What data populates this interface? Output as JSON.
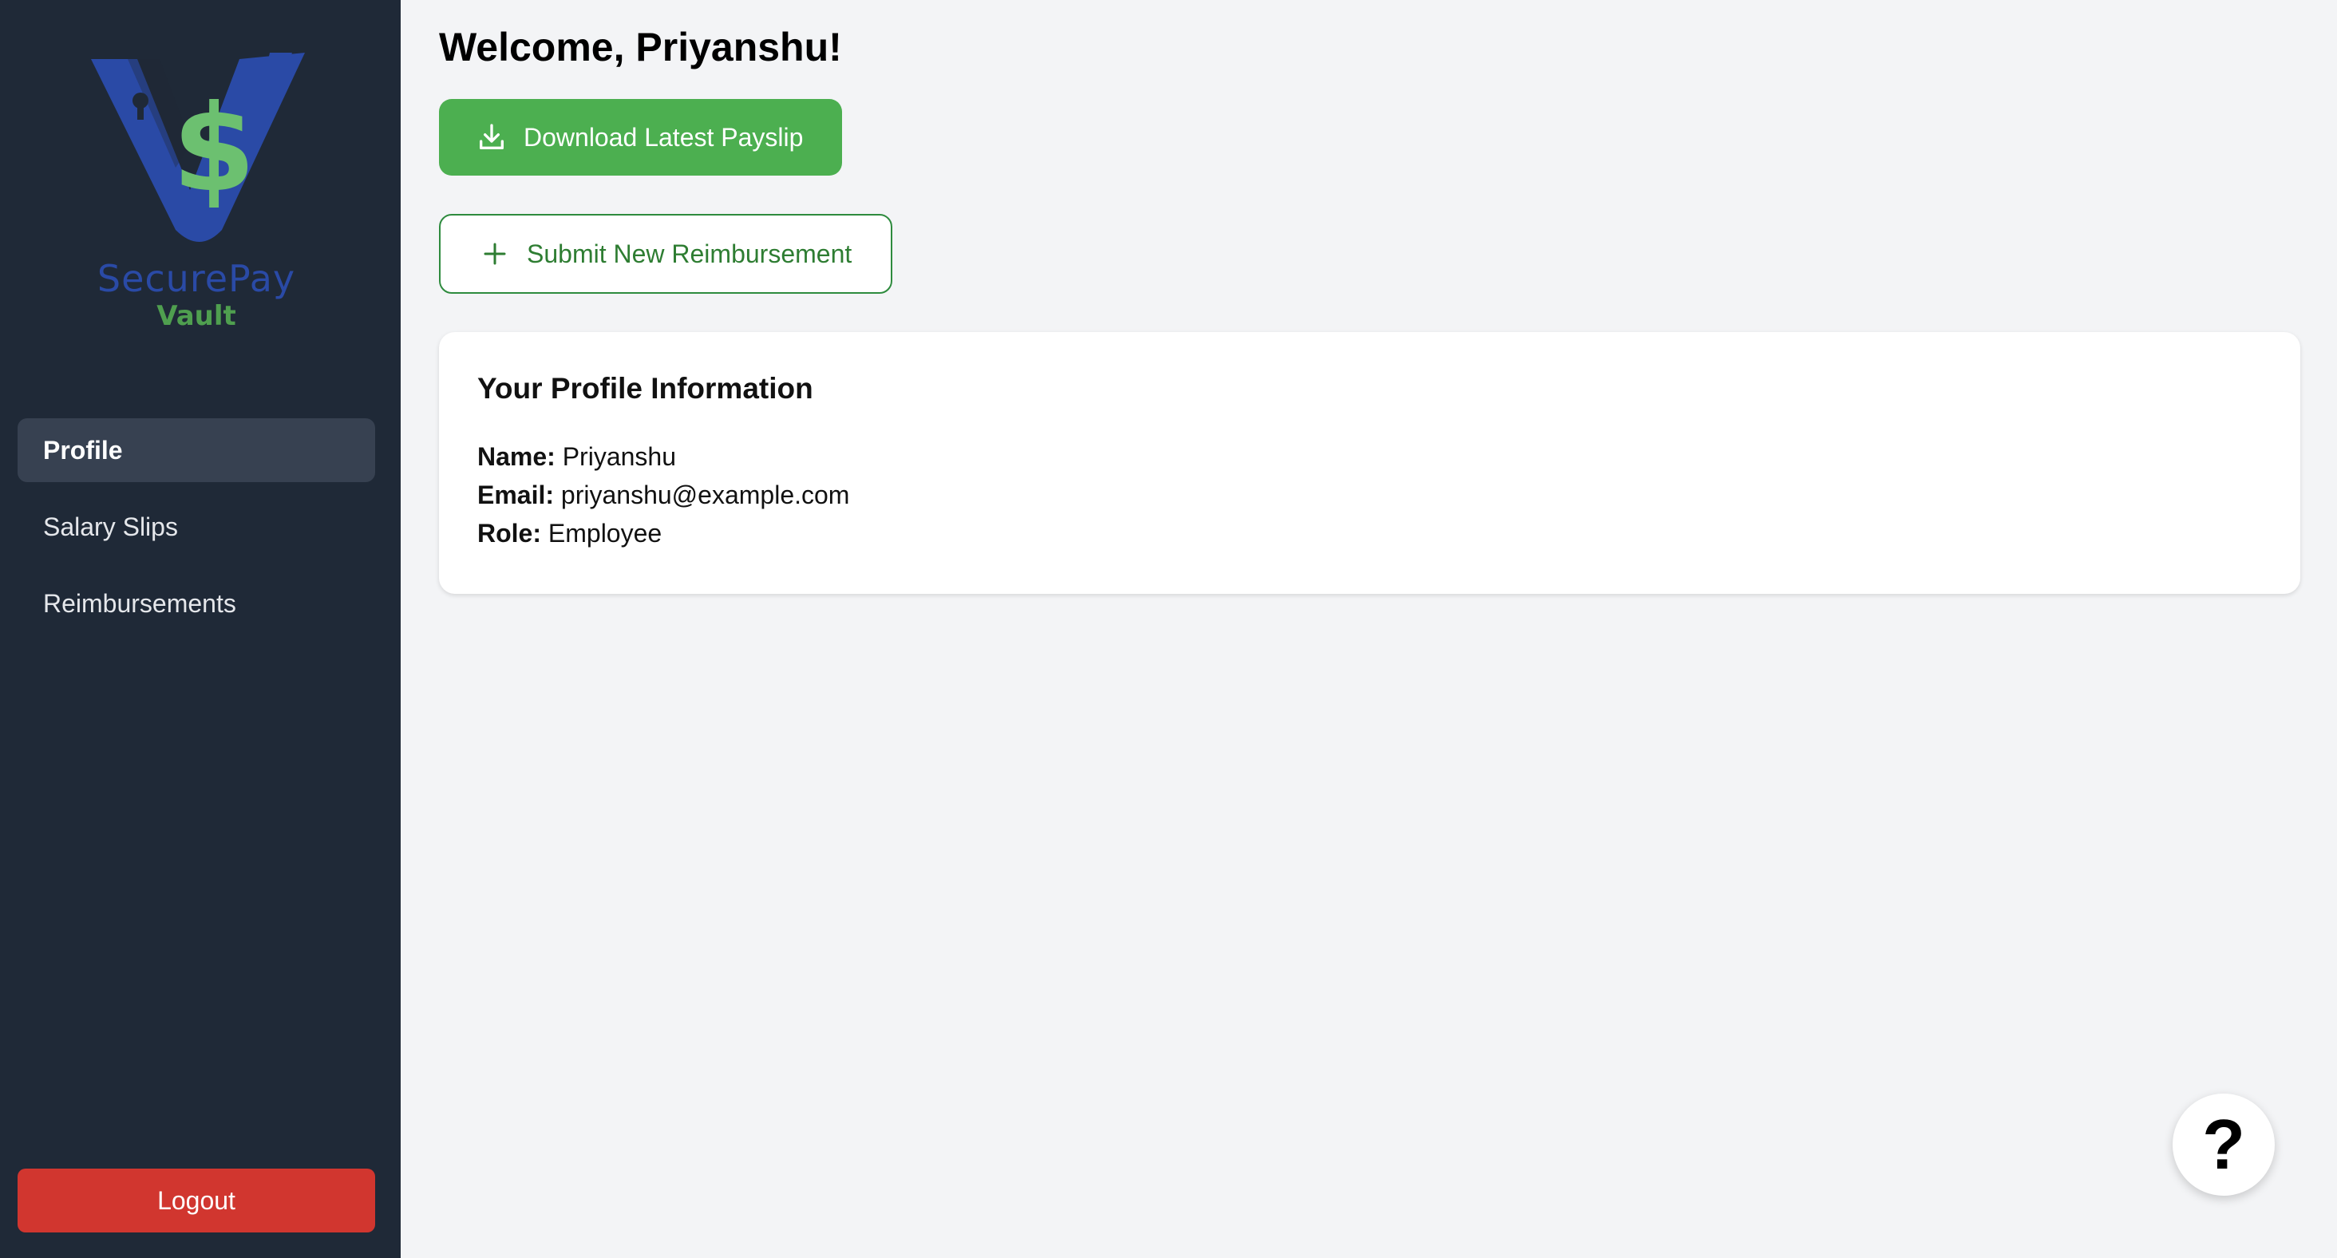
{
  "sidebar": {
    "logo": {
      "line1": "SecurePay",
      "line2": "Vault",
      "icon": "shield-dollar-logo"
    },
    "items": [
      {
        "label": "Profile",
        "active": true
      },
      {
        "label": "Salary Slips",
        "active": false
      },
      {
        "label": "Reimbursements",
        "active": false
      }
    ],
    "logout_label": "Logout"
  },
  "main": {
    "welcome": "Welcome, Priyanshu!",
    "download_button": {
      "label": "Download Latest Payslip",
      "icon": "download-icon"
    },
    "submit_button": {
      "label": "Submit New Reimbursement",
      "icon": "plus-icon"
    },
    "profile": {
      "title": "Your Profile Information",
      "name_label": "Name:",
      "name_value": "Priyanshu",
      "email_label": "Email:",
      "email_value": "priyanshu@example.com",
      "role_label": "Role:",
      "role_value": "Employee"
    }
  },
  "help_button": {
    "label": "?",
    "icon": "help-icon"
  },
  "colors": {
    "sidebar_bg": "#1f2937",
    "active_item_bg": "#374151",
    "primary_green": "#4caf50",
    "logout_red": "#d1362f",
    "page_bg": "#f3f4f6",
    "logo_blue": "#2a4aa6",
    "logo_green": "#4f9f4f"
  }
}
